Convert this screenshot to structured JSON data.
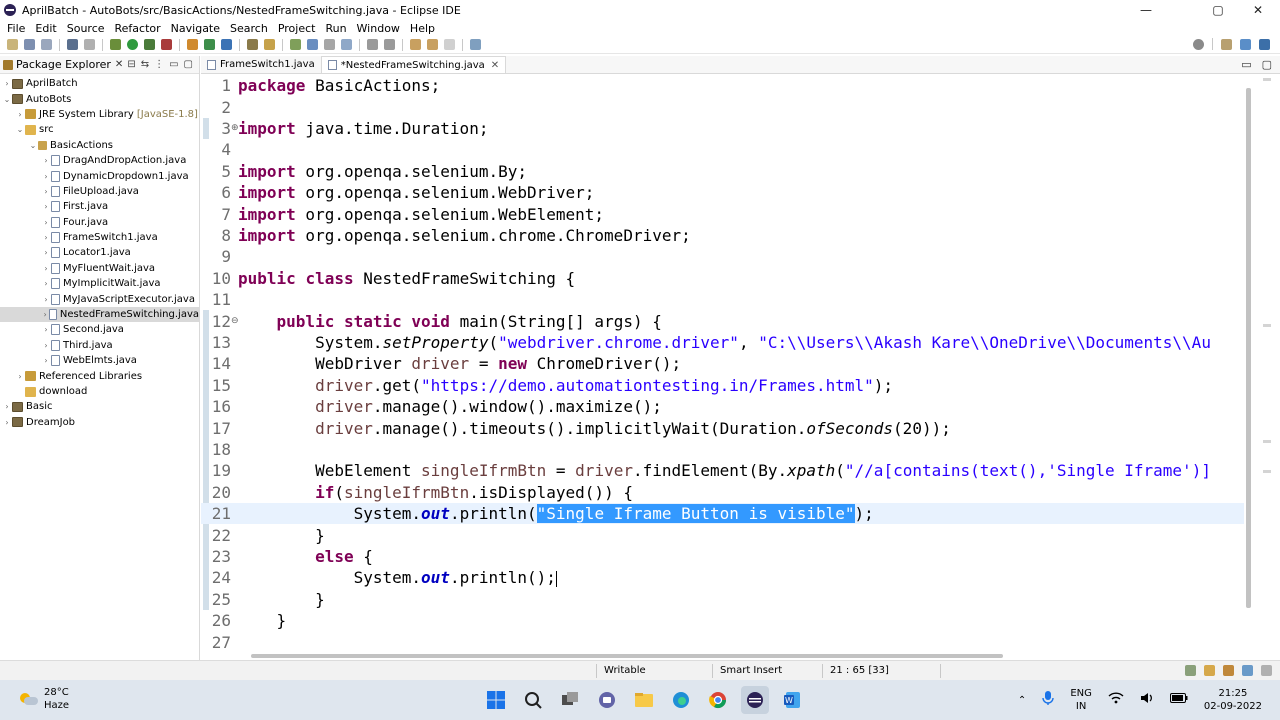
{
  "window": {
    "title": "AprilBatch - AutoBots/src/BasicActions/NestedFrameSwitching.java - Eclipse IDE",
    "minimize": "—",
    "maximize": "▢",
    "close": "✕"
  },
  "menu": [
    "File",
    "Edit",
    "Source",
    "Refactor",
    "Navigate",
    "Search",
    "Project",
    "Run",
    "Window",
    "Help"
  ],
  "explorer": {
    "title": "Package Explorer",
    "close": "✕",
    "items": [
      {
        "label": "AprilBatch",
        "decoration": "",
        "level": 0,
        "twisty": "›",
        "icon": "project"
      },
      {
        "label": "AutoBots",
        "decoration": "",
        "level": 0,
        "twisty": "⌄",
        "icon": "project"
      },
      {
        "label": "JRE System Library",
        "decoration": "[JavaSE-1.8]",
        "level": 1,
        "twisty": "›",
        "icon": "library"
      },
      {
        "label": "src",
        "decoration": "",
        "level": 1,
        "twisty": "⌄",
        "icon": "folder"
      },
      {
        "label": "BasicActions",
        "decoration": "",
        "level": 2,
        "twisty": "⌄",
        "icon": "package"
      },
      {
        "label": "DragAndDropAction.java",
        "decoration": "",
        "level": 3,
        "twisty": "›",
        "icon": "java"
      },
      {
        "label": "DynamicDropdown1.java",
        "decoration": "",
        "level": 3,
        "twisty": "›",
        "icon": "java"
      },
      {
        "label": "FileUpload.java",
        "decoration": "",
        "level": 3,
        "twisty": "›",
        "icon": "java"
      },
      {
        "label": "First.java",
        "decoration": "",
        "level": 3,
        "twisty": "›",
        "icon": "java"
      },
      {
        "label": "Four.java",
        "decoration": "",
        "level": 3,
        "twisty": "›",
        "icon": "java"
      },
      {
        "label": "FrameSwitch1.java",
        "decoration": "",
        "level": 3,
        "twisty": "›",
        "icon": "java"
      },
      {
        "label": "Locator1.java",
        "decoration": "",
        "level": 3,
        "twisty": "›",
        "icon": "java"
      },
      {
        "label": "MyFluentWait.java",
        "decoration": "",
        "level": 3,
        "twisty": "›",
        "icon": "java"
      },
      {
        "label": "MyImplicitWait.java",
        "decoration": "",
        "level": 3,
        "twisty": "›",
        "icon": "java"
      },
      {
        "label": "MyJavaScriptExecutor.java",
        "decoration": "",
        "level": 3,
        "twisty": "›",
        "icon": "java"
      },
      {
        "label": "NestedFrameSwitching.java",
        "decoration": "",
        "level": 3,
        "twisty": "›",
        "icon": "java",
        "selected": true
      },
      {
        "label": "Second.java",
        "decoration": "",
        "level": 3,
        "twisty": "›",
        "icon": "java"
      },
      {
        "label": "Third.java",
        "decoration": "",
        "level": 3,
        "twisty": "›",
        "icon": "java"
      },
      {
        "label": "WebElmts.java",
        "decoration": "",
        "level": 3,
        "twisty": "›",
        "icon": "java"
      },
      {
        "label": "Referenced Libraries",
        "decoration": "",
        "level": 1,
        "twisty": "›",
        "icon": "library"
      },
      {
        "label": "download",
        "decoration": "",
        "level": 1,
        "twisty": "",
        "icon": "folder"
      },
      {
        "label": "Basic",
        "decoration": "",
        "level": 0,
        "twisty": "›",
        "icon": "project"
      },
      {
        "label": "DreamJob",
        "decoration": "",
        "level": 0,
        "twisty": "›",
        "icon": "project"
      }
    ]
  },
  "editor": {
    "tabs": [
      {
        "label": "FrameSwitch1.java",
        "active": false,
        "close": ""
      },
      {
        "label": "*NestedFrameSwitching.java",
        "active": true,
        "close": "✕"
      }
    ],
    "lines": [
      {
        "n": "1",
        "fold": "",
        "html": "<span class='kw'>package</span> BasicActions;"
      },
      {
        "n": "2",
        "fold": "",
        "html": ""
      },
      {
        "n": "3",
        "fold": "⊕",
        "html": "<span class='kw'>import</span> java.time.Duration;"
      },
      {
        "n": "4",
        "fold": "",
        "html": ""
      },
      {
        "n": "5",
        "fold": "",
        "html": "<span class='kw'>import</span> org.openqa.selenium.By;"
      },
      {
        "n": "6",
        "fold": "",
        "html": "<span class='kw'>import</span> org.openqa.selenium.WebDriver;"
      },
      {
        "n": "7",
        "fold": "",
        "html": "<span class='kw'>import</span> org.openqa.selenium.WebElement;"
      },
      {
        "n": "8",
        "fold": "",
        "html": "<span class='kw'>import</span> org.openqa.selenium.chrome.ChromeDriver;"
      },
      {
        "n": "9",
        "fold": "",
        "html": ""
      },
      {
        "n": "10",
        "fold": "",
        "html": "<span class='kw'>public</span> <span class='kw'>class</span> NestedFrameSwitching {"
      },
      {
        "n": "11",
        "fold": "",
        "html": ""
      },
      {
        "n": "12",
        "fold": "⊖",
        "html": "    <span class='kw'>public</span> <span class='kw'>static</span> <span class='kw'>void</span> main(String[] args) {"
      },
      {
        "n": "13",
        "fold": "",
        "html": "        System.<span class='ital'>setProperty</span>(<span class='str'>\"webdriver.chrome.driver\"</span>, <span class='str'>\"C:\\\\Users\\\\Akash Kare\\\\OneDrive\\\\Documents\\\\Au</span>"
      },
      {
        "n": "14",
        "fold": "",
        "html": "        WebDriver <span class='var'>driver</span> = <span class='kw'>new</span> ChromeDriver();"
      },
      {
        "n": "15",
        "fold": "",
        "html": "        <span class='var'>driver</span>.get(<span class='str'>\"https://demo.automationtesting.in/Frames.html\"</span>);"
      },
      {
        "n": "16",
        "fold": "",
        "html": "        <span class='var'>driver</span>.manage().window().maximize();"
      },
      {
        "n": "17",
        "fold": "",
        "html": "        <span class='var'>driver</span>.manage().timeouts().implicitlyWait(Duration.<span class='ital'>ofSeconds</span>(20));"
      },
      {
        "n": "18",
        "fold": "",
        "html": ""
      },
      {
        "n": "19",
        "fold": "",
        "html": "        WebElement <span class='var'>singleIfrmBtn</span> = <span class='var'>driver</span>.findElement(By.<span class='ital'>xpath</span>(<span class='str'>\"//a[contains(text(),'Single Iframe')]</span>"
      },
      {
        "n": "20",
        "fold": "",
        "html": "        <span class='kw'>if</span>(<span class='var'>singleIfrmBtn</span>.isDisplayed()) {"
      },
      {
        "n": "21",
        "fold": "",
        "html": "            System.<span class='field'>out</span>.println(<span class='sel'>\"Single Iframe Button is visible\"</span>);",
        "current": true
      },
      {
        "n": "22",
        "fold": "",
        "html": "        }"
      },
      {
        "n": "23",
        "fold": "",
        "html": "        <span class='kw'>else</span> {"
      },
      {
        "n": "24",
        "fold": "",
        "html": "            System.<span class='field'>out</span>.println();<span class='caret'></span>"
      },
      {
        "n": "25",
        "fold": "",
        "html": "        }"
      },
      {
        "n": "26",
        "fold": "",
        "html": "    }"
      },
      {
        "n": "27",
        "fold": "",
        "html": ""
      }
    ]
  },
  "status": {
    "mode": "Writable",
    "insert": "Smart Insert",
    "position": "21 : 65 [33]"
  },
  "taskbar": {
    "temperature": "28°C",
    "weather": "Haze",
    "language_top": "ENG",
    "language_bottom": "IN",
    "time": "21:25",
    "date": "02-09-2022",
    "tray_up": "⌃"
  },
  "colors": {
    "keyword": "#7f0055",
    "string": "#2a00ff",
    "selection": "#3399ff",
    "current_line": "#e8f2fe",
    "taskbar": "#dfe6ee"
  }
}
